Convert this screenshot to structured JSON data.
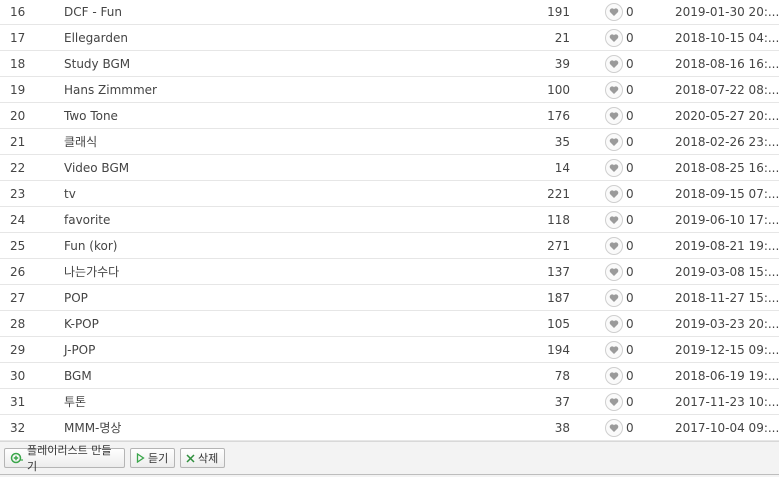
{
  "playlists": [
    {
      "num": "16",
      "title": "DCF - Fun",
      "count": "191",
      "likes": "0",
      "date": "2019-01-30 20:..."
    },
    {
      "num": "17",
      "title": "Ellegarden",
      "count": "21",
      "likes": "0",
      "date": "2018-10-15 04:..."
    },
    {
      "num": "18",
      "title": "Study BGM",
      "count": "39",
      "likes": "0",
      "date": "2018-08-16 16:..."
    },
    {
      "num": "19",
      "title": "Hans Zimmmer",
      "count": "100",
      "likes": "0",
      "date": "2018-07-22 08:..."
    },
    {
      "num": "20",
      "title": "Two Tone",
      "count": "176",
      "likes": "0",
      "date": "2020-05-27 20:..."
    },
    {
      "num": "21",
      "title": "클래식",
      "count": "35",
      "likes": "0",
      "date": "2018-02-26 23:..."
    },
    {
      "num": "22",
      "title": "Video BGM",
      "count": "14",
      "likes": "0",
      "date": "2018-08-25 16:..."
    },
    {
      "num": "23",
      "title": "tv",
      "count": "221",
      "likes": "0",
      "date": "2018-09-15 07:..."
    },
    {
      "num": "24",
      "title": "favorite",
      "count": "118",
      "likes": "0",
      "date": "2019-06-10 17:..."
    },
    {
      "num": "25",
      "title": "Fun (kor)",
      "count": "271",
      "likes": "0",
      "date": "2019-08-21 19:..."
    },
    {
      "num": "26",
      "title": "나는가수다",
      "count": "137",
      "likes": "0",
      "date": "2019-03-08 15:..."
    },
    {
      "num": "27",
      "title": "POP",
      "count": "187",
      "likes": "0",
      "date": "2018-11-27 15:..."
    },
    {
      "num": "28",
      "title": "K-POP",
      "count": "105",
      "likes": "0",
      "date": "2019-03-23 20:..."
    },
    {
      "num": "29",
      "title": "J-POP",
      "count": "194",
      "likes": "0",
      "date": "2019-12-15 09:..."
    },
    {
      "num": "30",
      "title": "BGM",
      "count": "78",
      "likes": "0",
      "date": "2018-06-19 19:..."
    },
    {
      "num": "31",
      "title": "투톤",
      "count": "37",
      "likes": "0",
      "date": "2017-11-23 10:..."
    },
    {
      "num": "32",
      "title": "MMM-명상",
      "count": "38",
      "likes": "0",
      "date": "2017-10-04 09:..."
    }
  ],
  "footer": {
    "make_playlist_label": "플레이리스트 만들기",
    "listen_label": "듣기",
    "delete_label": "삭제"
  },
  "icons": {
    "like": "heart-icon",
    "make_playlist": "add-playlist-icon",
    "listen": "play-icon",
    "delete": "close-icon"
  },
  "colors": {
    "add_icon": "#3aa64a",
    "delete_icon": "#2e8f3c",
    "heart": "#9a9a9a"
  }
}
